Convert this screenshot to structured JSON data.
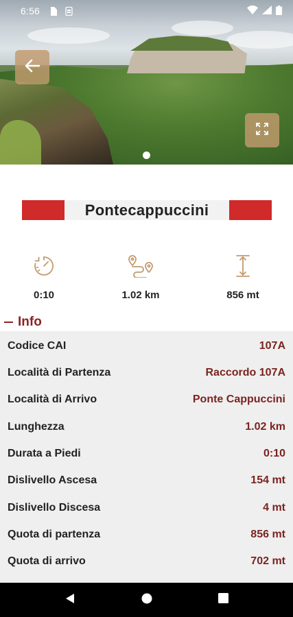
{
  "status_bar": {
    "time": "6:56",
    "icons": [
      "storage-icon",
      "sim-icon",
      "wifi-icon",
      "signal-icon",
      "battery-icon"
    ]
  },
  "hero": {
    "image_description_icon": "landscape-photo",
    "back_button_icon": "arrow-left-icon",
    "expand_button_icon": "fullscreen-icon",
    "carousel_index": 1,
    "carousel_count": 1
  },
  "trail": {
    "name": "Pontecappuccini",
    "banner_color": "#d02a2a"
  },
  "stats": [
    {
      "icon": "stopwatch-icon",
      "value": "0:10"
    },
    {
      "icon": "route-icon",
      "value": "1.02 km"
    },
    {
      "icon": "elevation-icon",
      "value": "856 mt"
    }
  ],
  "info": {
    "header": "Info",
    "rows": [
      {
        "label": "Codice CAI",
        "value": "107A"
      },
      {
        "label": "Località di Partenza",
        "value": "Raccordo 107A"
      },
      {
        "label": "Località di Arrivo",
        "value": "Ponte Cappuccini"
      },
      {
        "label": "Lunghezza",
        "value": "1.02 km"
      },
      {
        "label": "Durata a Piedi",
        "value": "0:10"
      },
      {
        "label": "Dislivello Ascesa",
        "value": "154 mt"
      },
      {
        "label": "Dislivello Discesa",
        "value": "4 mt"
      },
      {
        "label": "Quota di partenza",
        "value": "856 mt"
      },
      {
        "label": "Quota di arrivo",
        "value": "702 mt"
      }
    ]
  },
  "colors": {
    "accent_brown": "#c29a6e",
    "value_maroon": "#7a2420",
    "header_maroon": "#8b2323"
  },
  "nav_bar": {
    "buttons": [
      "back-triangle-icon",
      "home-circle-icon",
      "recents-square-icon"
    ]
  }
}
